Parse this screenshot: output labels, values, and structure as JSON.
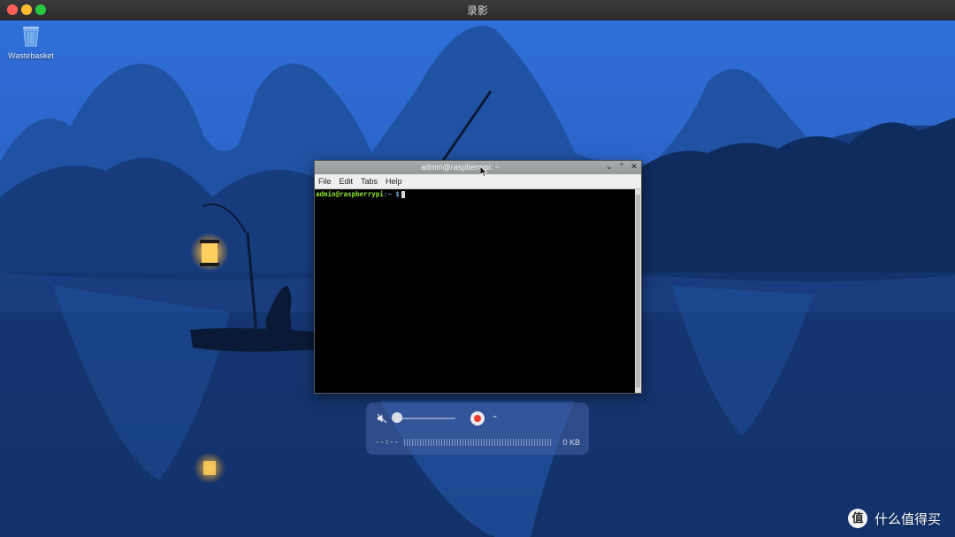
{
  "window": {
    "title": "录影"
  },
  "desktop": {
    "trash_label": "Wastebasket"
  },
  "terminal": {
    "title": "admin@raspberrypi: ~",
    "menu": [
      "File",
      "Edit",
      "Tabs",
      "Help"
    ],
    "prompt_user": "admin@raspberrypi",
    "prompt_sep": ":",
    "prompt_path": "~ $",
    "controls": {
      "minimize": "⌄",
      "maximize": "⌃",
      "close": "✕"
    }
  },
  "recorder": {
    "elapsed_time": "--:--",
    "file_size": "0 KB",
    "volume_level": 0,
    "muted": true,
    "chevron": "⌄",
    "record_color": "#f0382f"
  },
  "watermark": {
    "logo_glyph": "值",
    "text": "什么值得买"
  },
  "colors": {
    "prompt_user": "#8ae234",
    "prompt_path": "#729fcf"
  }
}
